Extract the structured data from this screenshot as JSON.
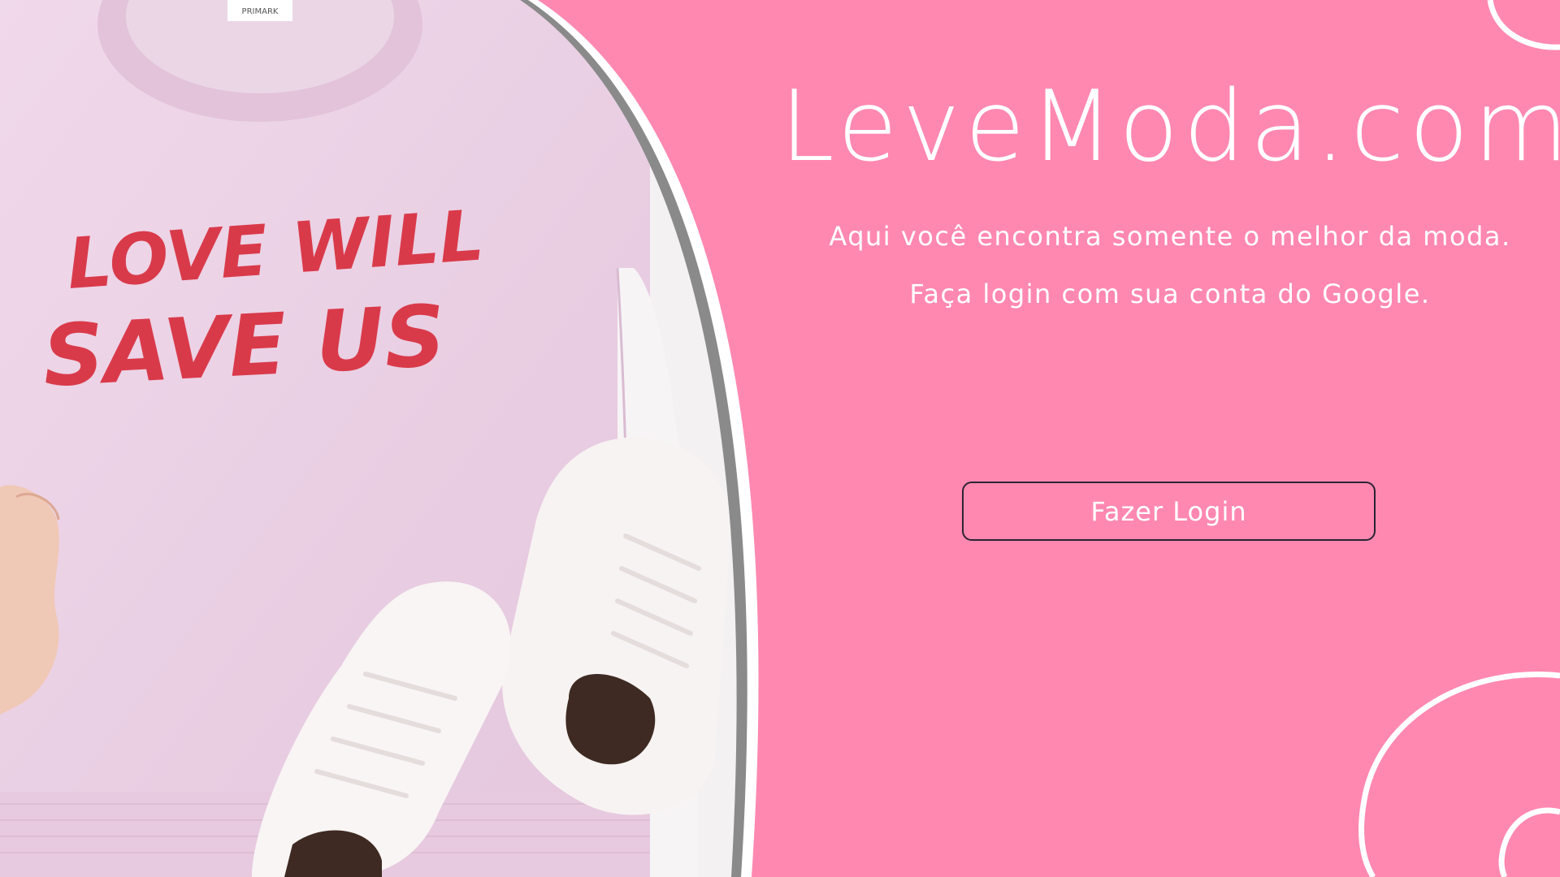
{
  "brand": {
    "title": "LeveModa.com"
  },
  "taglines": {
    "line1": "Aqui você encontra somente o melhor da moda.",
    "line2": "Faça login com sua conta do Google."
  },
  "login": {
    "button_label": "Fazer Login"
  },
  "photo": {
    "shirt_text_line1": "LOVE WILL",
    "shirt_text_line2": "SAVE US",
    "tag_label": "PRIMARK"
  },
  "colors": {
    "background": "#FF88B1",
    "text": "#FFFFFF",
    "button_border": "#2A2432",
    "sweater": "#EDD3E6",
    "print": "#D93A4A",
    "divider_gray": "#8A8A8A"
  }
}
